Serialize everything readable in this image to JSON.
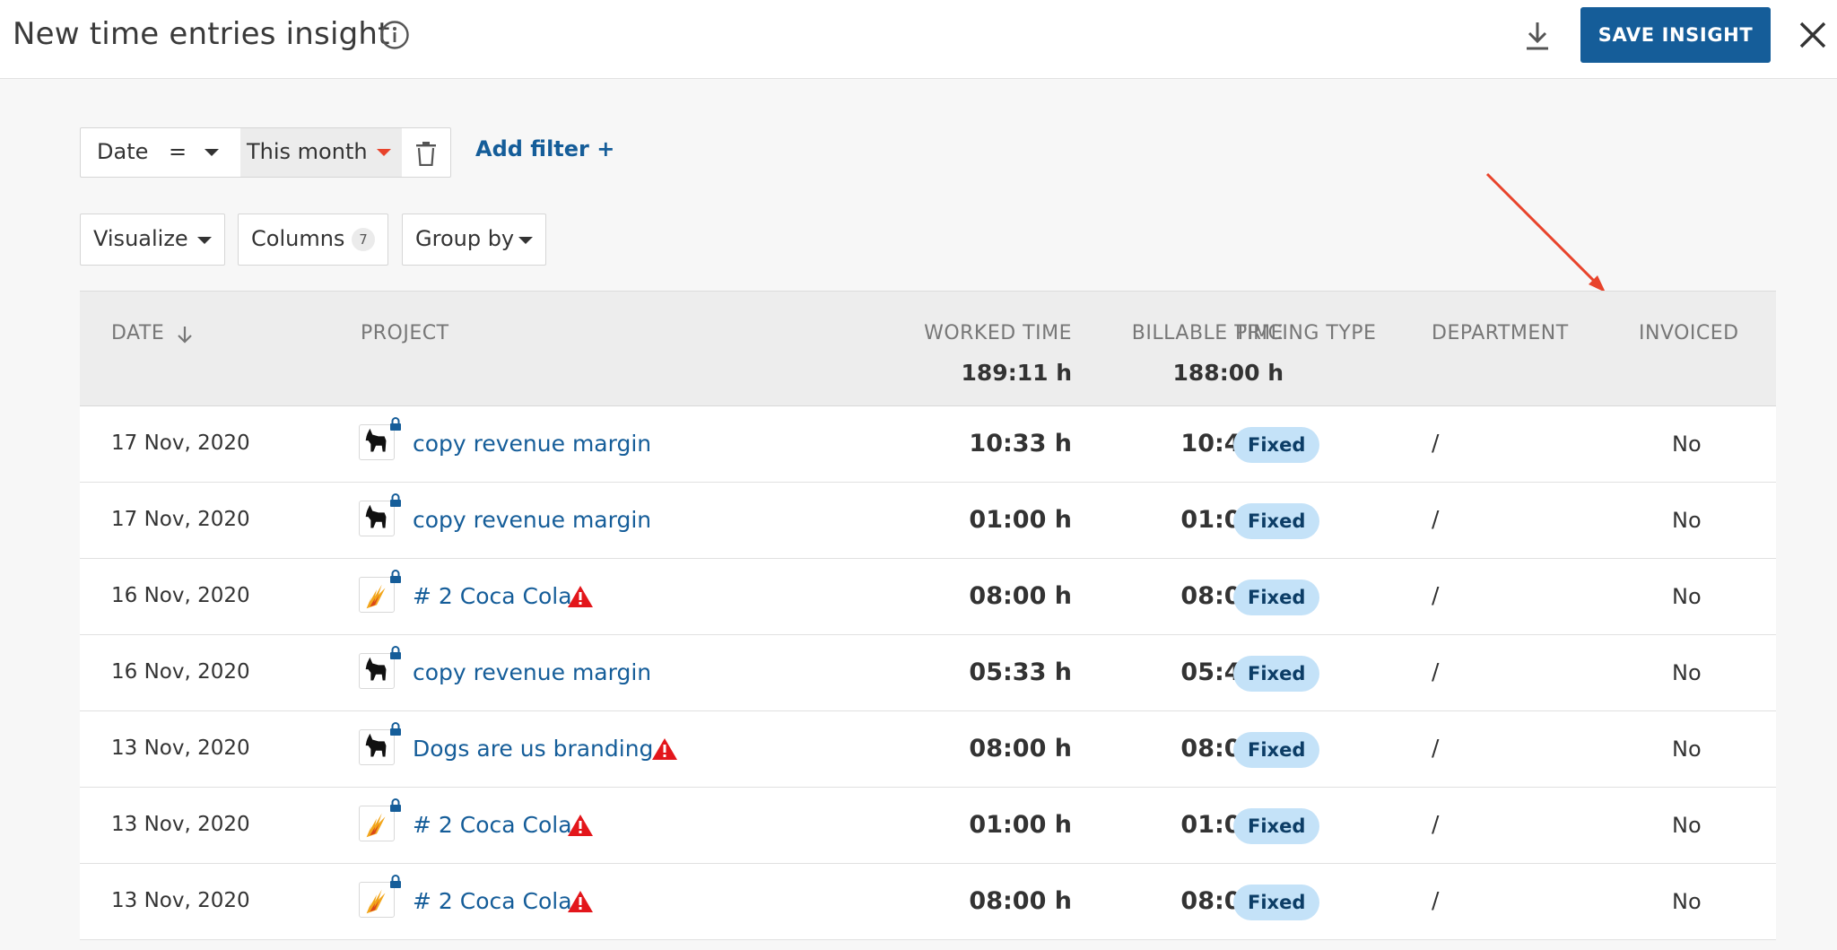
{
  "header": {
    "title": "New time entries insight",
    "save_label": "SAVE INSIGHT"
  },
  "filter": {
    "field": "Date",
    "operator": "=",
    "value": "This month",
    "add_label": "Add filter +"
  },
  "controls": {
    "visualize": "Visualize",
    "columns": "Columns",
    "columns_count": "7",
    "group_by": "Group by"
  },
  "table": {
    "headers": {
      "date": "DATE",
      "project": "PROJECT",
      "worked": "WORKED TIME",
      "billable": "BILLABLE TIME",
      "pricing": "PRICING TYPE",
      "department": "DEPARTMENT",
      "invoiced": "INVOICED"
    },
    "totals": {
      "worked": "189:11 h",
      "billable": "188:00 h"
    },
    "rows": [
      {
        "date": "17 Nov, 2020",
        "project": "copy revenue margin",
        "icon": "dog-icon",
        "warning": false,
        "worked": "10:33 h",
        "billable": "10:45 h",
        "pricing": "Fixed",
        "department": "/",
        "invoiced": "No"
      },
      {
        "date": "17 Nov, 2020",
        "project": "copy revenue margin",
        "icon": "dog-icon",
        "warning": false,
        "worked": "01:00 h",
        "billable": "01:00 h",
        "pricing": "Fixed",
        "department": "/",
        "invoiced": "No"
      },
      {
        "date": "16 Nov, 2020",
        "project": "# 2 Coca Cola",
        "icon": "flame-icon",
        "warning": true,
        "worked": "08:00 h",
        "billable": "08:00 h",
        "pricing": "Fixed",
        "department": "/",
        "invoiced": "No"
      },
      {
        "date": "16 Nov, 2020",
        "project": "copy revenue margin",
        "icon": "dog-icon",
        "warning": false,
        "worked": "05:33 h",
        "billable": "05:45 h",
        "pricing": "Fixed",
        "department": "/",
        "invoiced": "No"
      },
      {
        "date": "13 Nov, 2020",
        "project": "Dogs are us branding",
        "icon": "dog-icon",
        "warning": true,
        "worked": "08:00 h",
        "billable": "08:00 h",
        "pricing": "Fixed",
        "department": "/",
        "invoiced": "No"
      },
      {
        "date": "13 Nov, 2020",
        "project": "# 2 Coca Cola",
        "icon": "flame-icon",
        "warning": true,
        "worked": "01:00 h",
        "billable": "01:00 h",
        "pricing": "Fixed",
        "department": "/",
        "invoiced": "No"
      },
      {
        "date": "13 Nov, 2020",
        "project": "# 2 Coca Cola",
        "icon": "flame-icon",
        "warning": true,
        "worked": "08:00 h",
        "billable": "08:00 h",
        "pricing": "Fixed",
        "department": "/",
        "invoiced": "No"
      }
    ]
  },
  "colors": {
    "accent": "#155d99",
    "badge_bg": "#c4e2f8",
    "warning": "#e3161b",
    "annotation": "#e8432b"
  }
}
